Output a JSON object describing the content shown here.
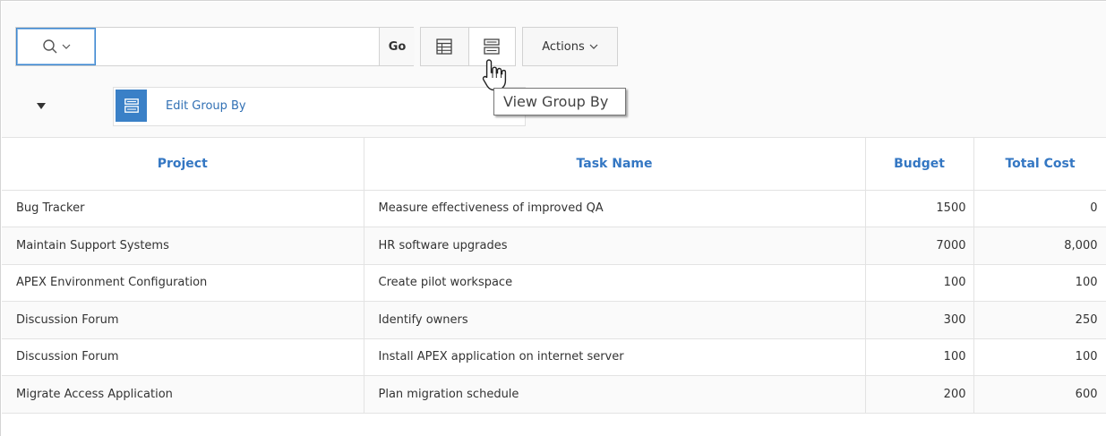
{
  "search": {
    "value": "",
    "placeholder": "",
    "go_label": "Go"
  },
  "toolbar": {
    "actions_label": "Actions"
  },
  "tooltip": {
    "text": "View Group By"
  },
  "group_by": {
    "label": "Edit Group By"
  },
  "table": {
    "headers": [
      "Project",
      "Task Name",
      "Budget",
      "Total Cost"
    ],
    "rows": [
      [
        "Bug Tracker",
        "Measure effectiveness of improved QA",
        "1500",
        "0"
      ],
      [
        "Maintain Support Systems",
        "HR software upgrades",
        "7000",
        "8,000"
      ],
      [
        "APEX Environment Configuration",
        "Create pilot workspace",
        "100",
        "100"
      ],
      [
        "Discussion Forum",
        "Identify owners",
        "300",
        "250"
      ],
      [
        "Discussion Forum",
        "Install APEX application on internet server",
        "100",
        "100"
      ],
      [
        "Migrate Access Application",
        "Plan migration schedule",
        "200",
        "600"
      ]
    ]
  },
  "colors": {
    "accent": "#3477c3",
    "focus": "#3f88cf",
    "chip_icon_bg": "#3a80c7"
  },
  "icons": {
    "search": "search-icon",
    "grid_view": "grid-view-icon",
    "group_view": "group-by-view-icon",
    "chevron": "chevron-down-icon",
    "cursor": "hand-cursor-icon"
  }
}
